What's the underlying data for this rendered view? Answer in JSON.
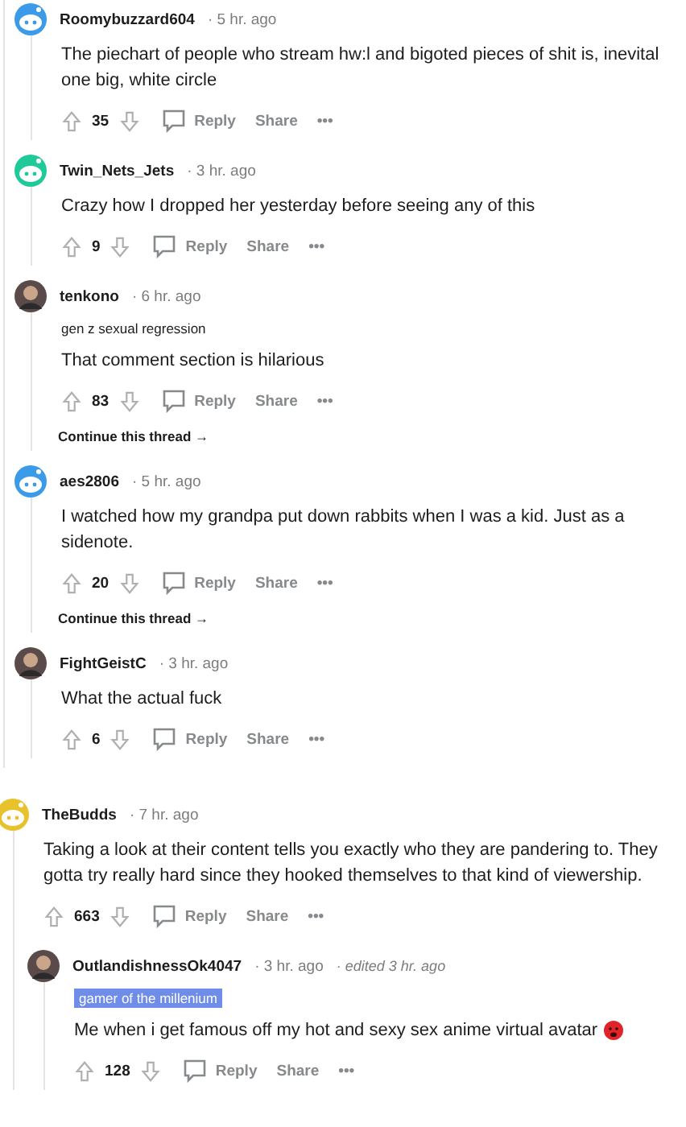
{
  "thread": {
    "replies": [
      {
        "author": "Roomybuzzard604",
        "time": "· 5 hr. ago",
        "avatar": {
          "kind": "snoo",
          "color": "#3b9be8"
        },
        "body": [
          "The piechart of people who stream hw:l and bigoted pieces of shit is, inevital",
          "one big, white circle"
        ],
        "score": "35",
        "actions": [
          "Reply",
          "Share",
          "•••"
        ]
      },
      {
        "author": "Twin_Nets_Jets",
        "time": "· 3 hr. ago",
        "avatar": {
          "kind": "snoo",
          "color": "#1fc99a"
        },
        "body": [
          "Crazy how I dropped her yesterday before seeing any of this"
        ],
        "score": "9",
        "actions": [
          "Reply",
          "Share",
          "•••"
        ]
      },
      {
        "author": "tenkono",
        "time": "· 6 hr. ago",
        "avatar": {
          "kind": "picture"
        },
        "flair": {
          "text": "gen z sexual regression",
          "kind": "plain"
        },
        "body": [
          "That comment section is hilarious"
        ],
        "score": "83",
        "actions": [
          "Reply",
          "Share",
          "•••"
        ],
        "continue": "Continue this thread →"
      },
      {
        "author": "aes2806",
        "time": "· 5 hr. ago",
        "avatar": {
          "kind": "snoo",
          "color": "#3b9be8"
        },
        "body": [
          "I watched how my grandpa put down rabbits when I was a kid. Just as a",
          "sidenote."
        ],
        "score": "20",
        "actions": [
          "Reply",
          "Share",
          "•••"
        ],
        "continue": "Continue this thread →"
      },
      {
        "author": "FightGeistC",
        "time": "· 3 hr. ago",
        "avatar": {
          "kind": "picture"
        },
        "body": [
          "What the actual fuck"
        ],
        "score": "6",
        "actions": [
          "Reply",
          "Share",
          "•••"
        ]
      }
    ]
  },
  "comments": [
    {
      "author": "TheBudds",
      "time": "· 7 hr. ago",
      "avatar": {
        "kind": "snoo",
        "color": "#e8c22a"
      },
      "body": [
        "Taking a look at their content tells you exactly who they are pandering to. They",
        "gotta try really hard since they hooked themselves to that kind of viewership."
      ],
      "score": "663",
      "actions": [
        "Reply",
        "Share",
        "•••"
      ],
      "replies": [
        {
          "author": "OutlandishnessOk4047",
          "time": "· 3 hr. ago",
          "edited": "· edited 3 hr. ago",
          "avatar": {
            "kind": "picture"
          },
          "flair": {
            "text": "gamer of the millenium",
            "kind": "badge"
          },
          "body": [
            "Me when i get famous off my hot and sexy sex anime virtual avatar"
          ],
          "emoji": true,
          "score": "128",
          "actions": [
            "Reply",
            "Share",
            "•••"
          ]
        }
      ]
    }
  ]
}
